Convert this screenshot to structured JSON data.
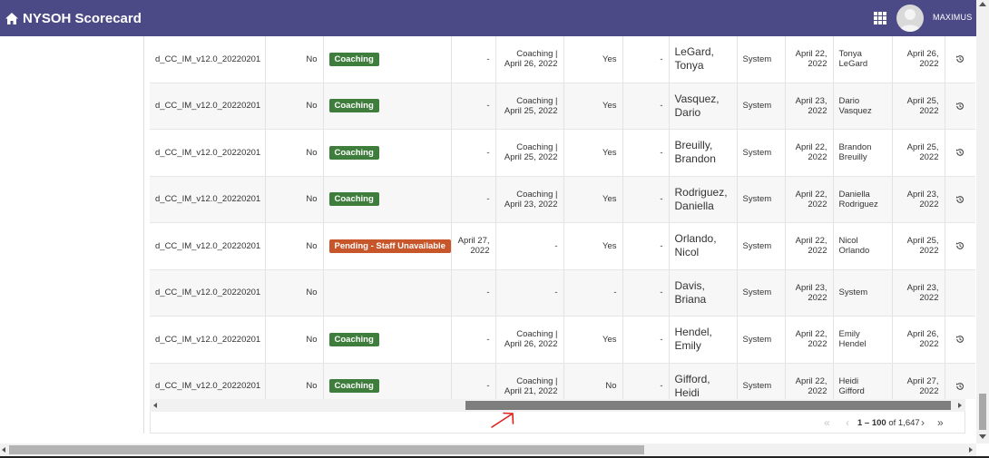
{
  "header": {
    "title": "NYSOH Scorecard",
    "user": "MAXIMUS",
    "brand_color": "#4b4a87"
  },
  "colors": {
    "coaching": "#3f7d3d",
    "pending": "#c8562b"
  },
  "rows": [
    {
      "form": "d_CC_IM_v12.0_20220201",
      "flag": "No",
      "status": "Coaching",
      "status_color": "green",
      "date1": "-",
      "coach_line1": "Coaching |",
      "coach_line2": "April 26, 2022",
      "ack": "Yes",
      "dash": "-",
      "agent_line1": "LeGard,",
      "agent_line2": "Tonya",
      "by": "System",
      "created_line1": "April 22,",
      "created_line2": "2022",
      "mod_line1": "Tonya",
      "mod_line2": "LeGard",
      "moddate_line1": "April 26,",
      "moddate_line2": "2022",
      "history": true
    },
    {
      "form": "d_CC_IM_v12.0_20220201",
      "flag": "No",
      "status": "Coaching",
      "status_color": "green",
      "date1": "-",
      "coach_line1": "Coaching |",
      "coach_line2": "April 25, 2022",
      "ack": "Yes",
      "dash": "-",
      "agent_line1": "Vasquez,",
      "agent_line2": "Dario",
      "by": "System",
      "created_line1": "April 23,",
      "created_line2": "2022",
      "mod_line1": "Dario",
      "mod_line2": "Vasquez",
      "moddate_line1": "April 25,",
      "moddate_line2": "2022",
      "history": true
    },
    {
      "form": "d_CC_IM_v12.0_20220201",
      "flag": "No",
      "status": "Coaching",
      "status_color": "green",
      "date1": "-",
      "coach_line1": "Coaching |",
      "coach_line2": "April 25, 2022",
      "ack": "Yes",
      "dash": "-",
      "agent_line1": "Breuilly,",
      "agent_line2": "Brandon",
      "by": "System",
      "created_line1": "April 22,",
      "created_line2": "2022",
      "mod_line1": "Brandon",
      "mod_line2": "Breuilly",
      "moddate_line1": "April 25,",
      "moddate_line2": "2022",
      "history": true
    },
    {
      "form": "d_CC_IM_v12.0_20220201",
      "flag": "No",
      "status": "Coaching",
      "status_color": "green",
      "date1": "-",
      "coach_line1": "Coaching |",
      "coach_line2": "April 23, 2022",
      "ack": "Yes",
      "dash": "-",
      "agent_line1": "Rodriguez,",
      "agent_line2": "Daniella",
      "by": "System",
      "created_line1": "April 22,",
      "created_line2": "2022",
      "mod_line1": "Daniella",
      "mod_line2": "Rodriguez",
      "moddate_line1": "April 23,",
      "moddate_line2": "2022",
      "history": true
    },
    {
      "form": "d_CC_IM_v12.0_20220201",
      "flag": "No",
      "status": "Pending - Staff Unavailable",
      "status_color": "orange",
      "date1_line1": "April 27,",
      "date1_line2": "2022",
      "coach": "-",
      "ack": "Yes",
      "dash": "-",
      "agent_line1": "Orlando,",
      "agent_line2": "Nicol",
      "by": "System",
      "created_line1": "April 22,",
      "created_line2": "2022",
      "mod_line1": "Nicol",
      "mod_line2": "Orlando",
      "moddate_line1": "April 25,",
      "moddate_line2": "2022",
      "history": true
    },
    {
      "form": "d_CC_IM_v12.0_20220201",
      "flag": "No",
      "status": "",
      "date1": "-",
      "coach": "-",
      "ack": "-",
      "dash": "-",
      "agent_line1": "Davis,",
      "agent_line2": "Briana",
      "by": "System",
      "created_line1": "April 23,",
      "created_line2": "2022",
      "mod": "System",
      "moddate_line1": "April 23,",
      "moddate_line2": "2022",
      "history": false
    },
    {
      "form": "d_CC_IM_v12.0_20220201",
      "flag": "No",
      "status": "Coaching",
      "status_color": "green",
      "date1": "-",
      "coach_line1": "Coaching |",
      "coach_line2": "April 26, 2022",
      "ack": "Yes",
      "dash": "-",
      "agent_line1": "Hendel,",
      "agent_line2": "Emily",
      "by": "System",
      "created_line1": "April 22,",
      "created_line2": "2022",
      "mod_line1": "Emily",
      "mod_line2": "Hendel",
      "moddate_line1": "April 26,",
      "moddate_line2": "2022",
      "history": true
    },
    {
      "form": "d_CC_IM_v12.0_20220201",
      "flag": "No",
      "status": "Coaching",
      "status_color": "green",
      "date1": "-",
      "coach_line1": "Coaching |",
      "coach_line2": "April 21, 2022",
      "ack": "No",
      "dash": "-",
      "agent_line1": "Gifford,",
      "agent_line2": "Heidi",
      "by": "System",
      "created_line1": "April 22,",
      "created_line2": "2022",
      "mod_line1": "Heidi",
      "mod_line2": "Gifford",
      "moddate_line1": "April 27,",
      "moddate_line2": "2022",
      "history": true
    }
  ],
  "pagination": {
    "range": "1 – 100",
    "of_label": "of",
    "total": "1,647"
  }
}
